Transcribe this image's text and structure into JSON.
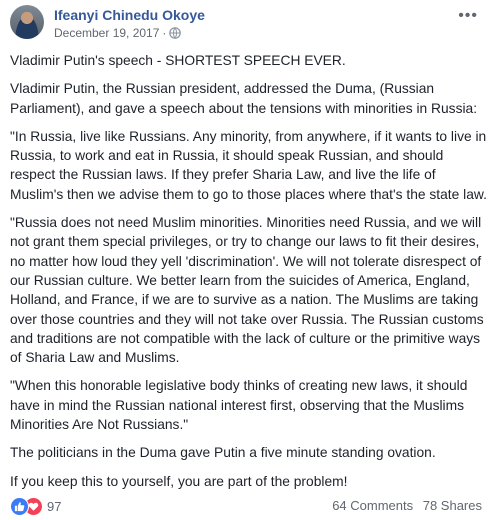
{
  "post": {
    "author": "Ifeanyi Chinedu Okoye",
    "date": "December 19, 2017",
    "separator": "·",
    "options_glyph": "•••",
    "paragraphs": [
      "Vladimir Putin's speech - SHORTEST SPEECH EVER.",
      "Vladimir Putin, the Russian president, addressed the Duma, (Russian Parliament), and gave a speech about the tensions with minorities in Russia:",
      "\"In Russia, live like Russians. Any minority, from anywhere, if it wants to live in Russia, to work and eat in Russia, it should speak Russian, and should respect the Russian laws. If they prefer Sharia Law, and live the life of Muslim's then we advise them to go to those places where that's the state law.",
      "\"Russia does not need Muslim minorities. Minorities need Russia, and we will not grant them special privileges, or try to change our laws to fit their desires, no matter how loud they yell 'discrimination'. We will not tolerate disrespect of our Russian culture. We better learn from the suicides of America, England, Holland, and France, if we are to survive as a nation. The Muslims are taking over those countries and they will not take over Russia. The Russian customs and traditions are not compatible with the lack of culture or the primitive ways of Sharia Law and Muslims.",
      "\"When this honorable legislative body thinks of creating new laws, it should have in mind the Russian national interest first, observing that the Muslims Minorities Are Not Russians.\"",
      "The politicians in the Duma gave Putin a five minute standing ovation.",
      "If you keep this to yourself, you are part of the problem!"
    ],
    "icons": {
      "privacy": "globe-icon",
      "like": "like-reaction-icon",
      "love": "love-reaction-icon",
      "options": "more-options-icon"
    }
  },
  "footer": {
    "reaction_count": "97",
    "comments": "64 Comments",
    "shares": "78 Shares"
  },
  "colors": {
    "name_link": "#365899",
    "meta": "#616770",
    "text": "#1d2129",
    "like": "#3b7bf6",
    "love": "#f2415b"
  }
}
